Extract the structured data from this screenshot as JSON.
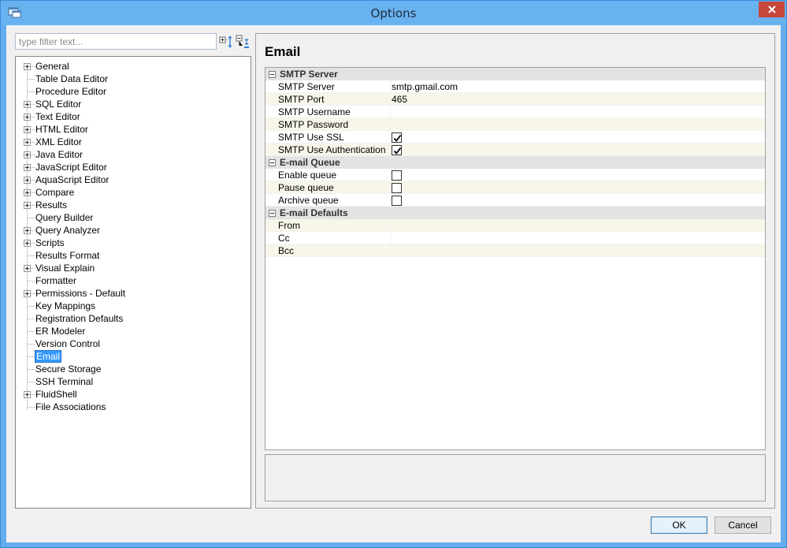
{
  "window": {
    "title": "Options",
    "accent_color": "#64aeee",
    "close_color": "#c7463a"
  },
  "filter": {
    "placeholder": "type filter text...",
    "expand_icon": "expand-all-icon",
    "collapse_icon": "collapse-all-icon"
  },
  "tree": {
    "items": [
      {
        "label": "General",
        "expandable": true
      },
      {
        "label": "Table Data Editor",
        "expandable": false
      },
      {
        "label": "Procedure Editor",
        "expandable": false
      },
      {
        "label": "SQL Editor",
        "expandable": true
      },
      {
        "label": "Text Editor",
        "expandable": true
      },
      {
        "label": "HTML Editor",
        "expandable": true
      },
      {
        "label": "XML Editor",
        "expandable": true
      },
      {
        "label": "Java Editor",
        "expandable": true
      },
      {
        "label": "JavaScript Editor",
        "expandable": true
      },
      {
        "label": "AquaScript Editor",
        "expandable": true
      },
      {
        "label": "Compare",
        "expandable": true
      },
      {
        "label": "Results",
        "expandable": true
      },
      {
        "label": "Query Builder",
        "expandable": false
      },
      {
        "label": "Query Analyzer",
        "expandable": true
      },
      {
        "label": "Scripts",
        "expandable": true
      },
      {
        "label": "Results Format",
        "expandable": false
      },
      {
        "label": "Visual Explain",
        "expandable": true
      },
      {
        "label": "Formatter",
        "expandable": false
      },
      {
        "label": "Permissions - Default",
        "expandable": true
      },
      {
        "label": "Key Mappings",
        "expandable": false
      },
      {
        "label": "Registration Defaults",
        "expandable": false
      },
      {
        "label": "ER Modeler",
        "expandable": false
      },
      {
        "label": "Version Control",
        "expandable": false
      },
      {
        "label": "Email",
        "expandable": false,
        "selected": true
      },
      {
        "label": "Secure Storage",
        "expandable": false
      },
      {
        "label": "SSH Terminal",
        "expandable": false
      },
      {
        "label": "FluidShell",
        "expandable": true
      },
      {
        "label": "File Associations",
        "expandable": false
      }
    ]
  },
  "page": {
    "title": "Email"
  },
  "grid": {
    "categories": [
      {
        "label": "SMTP Server",
        "rows": [
          {
            "name": "SMTP Server",
            "type": "text",
            "value": "smtp.gmail.com"
          },
          {
            "name": "SMTP Port",
            "type": "text",
            "value": "465"
          },
          {
            "name": "SMTP Username",
            "type": "text",
            "value": ""
          },
          {
            "name": "SMTP Password",
            "type": "text",
            "value": ""
          },
          {
            "name": "SMTP Use SSL",
            "type": "checkbox",
            "checked": true
          },
          {
            "name": "SMTP Use Authentication",
            "type": "checkbox",
            "checked": true
          }
        ]
      },
      {
        "label": "E-mail Queue",
        "rows": [
          {
            "name": "Enable queue",
            "type": "checkbox",
            "checked": false
          },
          {
            "name": "Pause queue",
            "type": "checkbox",
            "checked": false
          },
          {
            "name": "Archive queue",
            "type": "checkbox",
            "checked": false
          }
        ]
      },
      {
        "label": "E-mail Defaults",
        "rows": [
          {
            "name": "From",
            "type": "text",
            "value": ""
          },
          {
            "name": "Cc",
            "type": "text",
            "value": ""
          },
          {
            "name": "Bcc",
            "type": "text",
            "value": ""
          }
        ]
      }
    ]
  },
  "buttons": {
    "ok": "OK",
    "cancel": "Cancel"
  }
}
